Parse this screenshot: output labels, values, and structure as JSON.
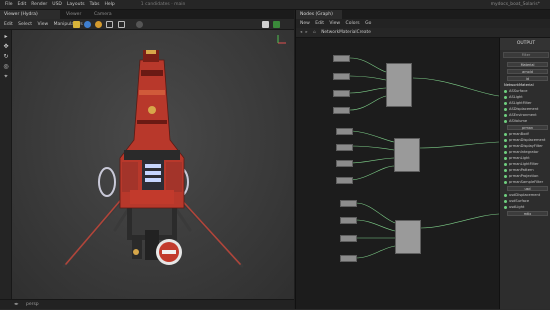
{
  "menubar": {
    "items": [
      "File",
      "Edit",
      "Render",
      "USD",
      "Layouts",
      "Tabs",
      "Help"
    ],
    "context": "1 candidates · main",
    "title": "mydocs_boat_Solaris*"
  },
  "left_panel": {
    "tabs": [
      {
        "label": "Viewer (Hydra)",
        "active": true
      },
      {
        "label": "Viewer",
        "active": false
      },
      {
        "label": "Camera",
        "active": false
      }
    ],
    "menu": [
      "Edit",
      "Select",
      "View",
      "Manipulators"
    ],
    "status_text": "persp",
    "tools": [
      "select-icon",
      "move-icon",
      "rotate-icon",
      "scale-icon",
      "snap-icon"
    ]
  },
  "right_panel": {
    "tabs": [
      {
        "label": "Nodes (Graph)",
        "active": true
      }
    ],
    "menu": [
      "New",
      "Edit",
      "View",
      "Colors",
      "Go"
    ],
    "path": "NetworkMaterialCreate",
    "output_panel": {
      "title": "OUTPUT",
      "search_placeholder": "Filter",
      "rows": [
        {
          "kind": "box",
          "label": "Material"
        },
        {
          "kind": "box",
          "label": "arnold"
        },
        {
          "kind": "box",
          "label": "id"
        },
        {
          "kind": "hdr",
          "label": "NetworkMaterial"
        },
        {
          "kind": "port",
          "label": "ASSurface"
        },
        {
          "kind": "port",
          "label": "ASLight"
        },
        {
          "kind": "port",
          "label": "ASLightFilter"
        },
        {
          "kind": "port",
          "label": "ASDisplacement"
        },
        {
          "kind": "port",
          "label": "ASEnvironment"
        },
        {
          "kind": "port",
          "label": "ASVolume"
        },
        {
          "kind": "box",
          "label": "prman"
        },
        {
          "kind": "port",
          "label": "prmanBxdf"
        },
        {
          "kind": "port",
          "label": "prmanDisplacement"
        },
        {
          "kind": "port",
          "label": "prmanDisplayFilter"
        },
        {
          "kind": "port",
          "label": "prmanIntegrator"
        },
        {
          "kind": "port",
          "label": "prmanLight"
        },
        {
          "kind": "port",
          "label": "prmanLightFilter"
        },
        {
          "kind": "port",
          "label": "prmanPattern"
        },
        {
          "kind": "port",
          "label": "prmanProjection"
        },
        {
          "kind": "port",
          "label": "prmanSampleFilter"
        },
        {
          "kind": "box",
          "label": "usd"
        },
        {
          "kind": "port",
          "label": "usdDisplacement"
        },
        {
          "kind": "port",
          "label": "usdSurface"
        },
        {
          "kind": "port",
          "label": "usdLight"
        },
        {
          "kind": "box",
          "label": "mtlx"
        }
      ]
    }
  },
  "colors": {
    "ship_red": "#c23a2c",
    "ship_dark": "#2a2a2a",
    "wire": "#7fd08a",
    "node": "#8c8c8c",
    "port": "#6fcf7f"
  }
}
